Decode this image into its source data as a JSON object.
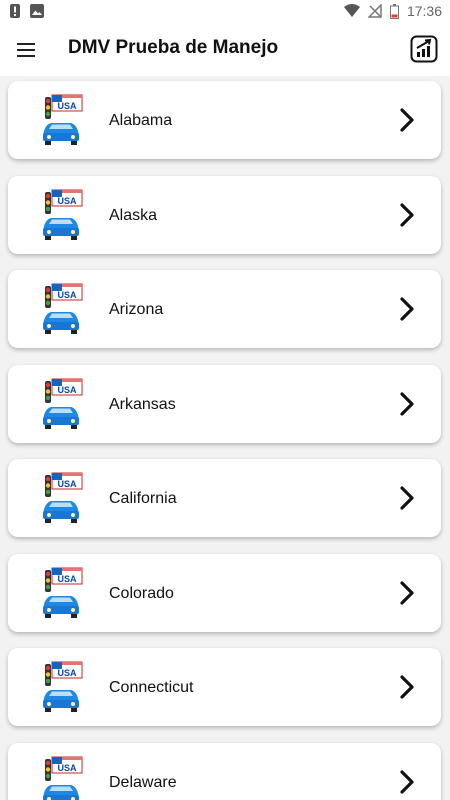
{
  "status": {
    "time": "17:36"
  },
  "appbar": {
    "title": "DMV Prueba de Manejo"
  },
  "icons": {
    "menu": "menu-icon",
    "stats": "stats-icon",
    "chevron": "chevron-right-icon",
    "logo": "usa-car-logo"
  },
  "colors": {
    "car": "#1e88e5",
    "accent": "#d32f2f"
  },
  "states": [
    {
      "name": "Alabama",
      "logo_text": "USA"
    },
    {
      "name": "Alaska",
      "logo_text": "USA"
    },
    {
      "name": "Arizona",
      "logo_text": "USA"
    },
    {
      "name": "Arkansas",
      "logo_text": "USA"
    },
    {
      "name": "California",
      "logo_text": "USA"
    },
    {
      "name": "Colorado",
      "logo_text": "USA"
    },
    {
      "name": "Connecticut",
      "logo_text": "USA"
    },
    {
      "name": "Delaware",
      "logo_text": "USA"
    }
  ]
}
